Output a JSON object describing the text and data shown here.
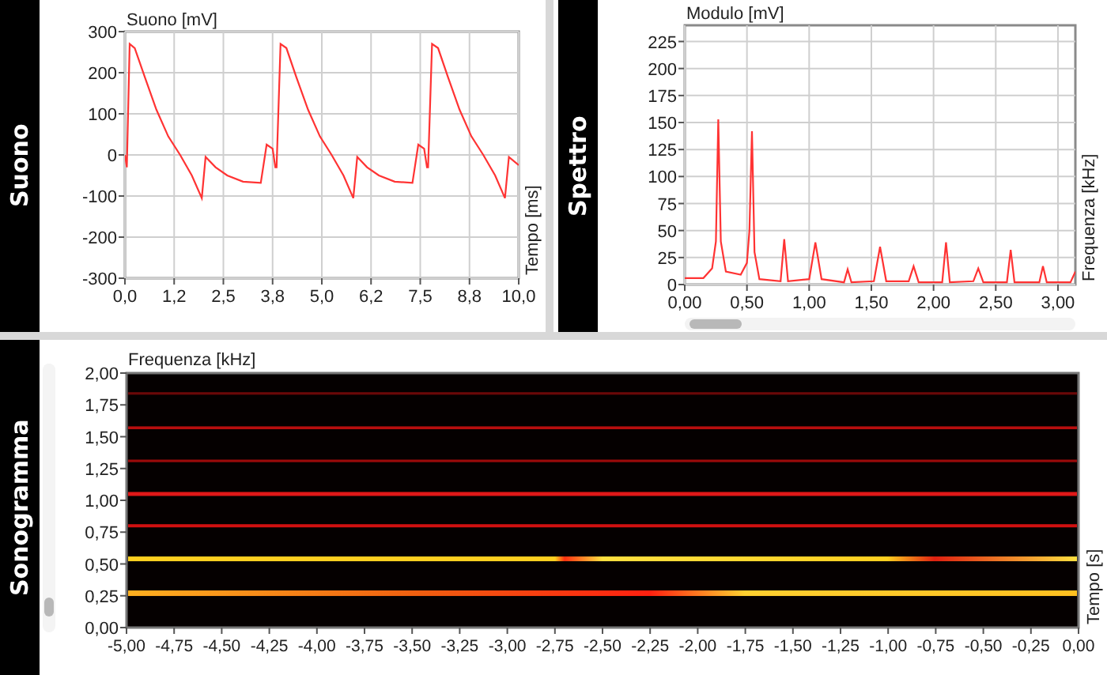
{
  "suono": {
    "label": "Suono",
    "x_axis_caption": "Tempo [ms]",
    "chart_data": {
      "type": "line",
      "grid": true,
      "ylabel": "Suono [mV]",
      "xlim": [
        0,
        10
      ],
      "ylim": [
        -300,
        300
      ],
      "xticks": [
        {
          "value": 0,
          "label": "0,0"
        },
        {
          "value": 1.25,
          "label": "1,2"
        },
        {
          "value": 2.5,
          "label": "2,5"
        },
        {
          "value": 3.75,
          "label": "3,8"
        },
        {
          "value": 5,
          "label": "5,0"
        },
        {
          "value": 6.25,
          "label": "6,2"
        },
        {
          "value": 7.5,
          "label": "7,5"
        },
        {
          "value": 8.75,
          "label": "8,8"
        },
        {
          "value": 10,
          "label": "10,0"
        }
      ],
      "yticks": [
        -300,
        -200,
        -100,
        0,
        100,
        200,
        300
      ],
      "x": [
        0,
        0.05,
        0.12,
        0.25,
        0.5,
        0.8,
        1.1,
        1.4,
        1.7,
        1.95,
        2.05,
        2.3,
        2.6,
        3.0,
        3.45,
        3.6,
        3.75,
        3.82,
        3.85,
        3.95,
        4.1,
        4.35,
        4.65,
        4.95,
        5.25,
        5.55,
        5.8,
        5.9,
        6.15,
        6.45,
        6.85,
        7.3,
        7.45,
        7.6,
        7.67,
        7.7,
        7.8,
        7.95,
        8.2,
        8.5,
        8.8,
        9.1,
        9.4,
        9.65,
        9.75,
        10.0
      ],
      "series": [
        {
          "color": "#ff3333",
          "values": [
            0,
            -30,
            270,
            260,
            190,
            110,
            45,
            0,
            -50,
            -105,
            -5,
            -30,
            -50,
            -65,
            -68,
            25,
            15,
            -30,
            -30,
            270,
            260,
            190,
            110,
            45,
            0,
            -50,
            -105,
            -5,
            -30,
            -50,
            -65,
            -68,
            25,
            15,
            -30,
            -30,
            270,
            260,
            190,
            110,
            45,
            0,
            -50,
            -105,
            -5,
            -25
          ]
        }
      ]
    }
  },
  "spettro": {
    "label": "Spettro",
    "x_axis_caption": "Frequenza [kHz]",
    "chart_data": {
      "type": "line",
      "grid": true,
      "ylabel": "Modulo [mV]",
      "xlim": [
        0,
        3.14
      ],
      "ylim": [
        0,
        240
      ],
      "xticks": [
        {
          "value": 0,
          "label": "0,00"
        },
        {
          "value": 0.5,
          "label": "0,50"
        },
        {
          "value": 1,
          "label": "1,00"
        },
        {
          "value": 1.5,
          "label": "1,50"
        },
        {
          "value": 2,
          "label": "2,00"
        },
        {
          "value": 2.5,
          "label": "2,50"
        },
        {
          "value": 3,
          "label": "3,00"
        }
      ],
      "yticks": [
        0,
        25,
        50,
        75,
        100,
        125,
        150,
        175,
        200,
        225
      ],
      "x": [
        0,
        0.15,
        0.22,
        0.25,
        0.27,
        0.29,
        0.33,
        0.45,
        0.5,
        0.52,
        0.54,
        0.56,
        0.6,
        0.77,
        0.8,
        0.83,
        1.0,
        1.05,
        1.1,
        1.28,
        1.31,
        1.34,
        1.52,
        1.57,
        1.62,
        1.8,
        1.84,
        1.88,
        2.07,
        2.1,
        2.13,
        2.32,
        2.36,
        2.4,
        2.59,
        2.62,
        2.65,
        2.85,
        2.88,
        2.91,
        3.1,
        3.14
      ],
      "series": [
        {
          "color": "#ff3333",
          "values": [
            6,
            6,
            15,
            40,
            153,
            40,
            12,
            9,
            20,
            50,
            142,
            30,
            5,
            3,
            42,
            3,
            5,
            39,
            5,
            2,
            14,
            2,
            3,
            35,
            3,
            3,
            17,
            2,
            2,
            39,
            2,
            3,
            15,
            2,
            2,
            32,
            2,
            2,
            17,
            2,
            2,
            12
          ]
        }
      ]
    }
  },
  "sonogramma": {
    "label": "Sonogramma",
    "ylabel": "Frequenza [kHz]",
    "xlabel": "Tempo [s]",
    "yticks": [
      "2,00",
      "1,75",
      "1,50",
      "1,25",
      "1,00",
      "0,75",
      "0,50",
      "0,25",
      "0,00"
    ],
    "xticks": [
      "-5,00",
      "-4,75",
      "-4,50",
      "-4,25",
      "-4,00",
      "-3,75",
      "-3,50",
      "-3,25",
      "-3,00",
      "-2,75",
      "-2,50",
      "-2,25",
      "-2,00",
      "-1,75",
      "-1,50",
      "-1,25",
      "-1,00",
      "-0,75",
      "-0,50",
      "-0,25",
      "0,00"
    ]
  }
}
